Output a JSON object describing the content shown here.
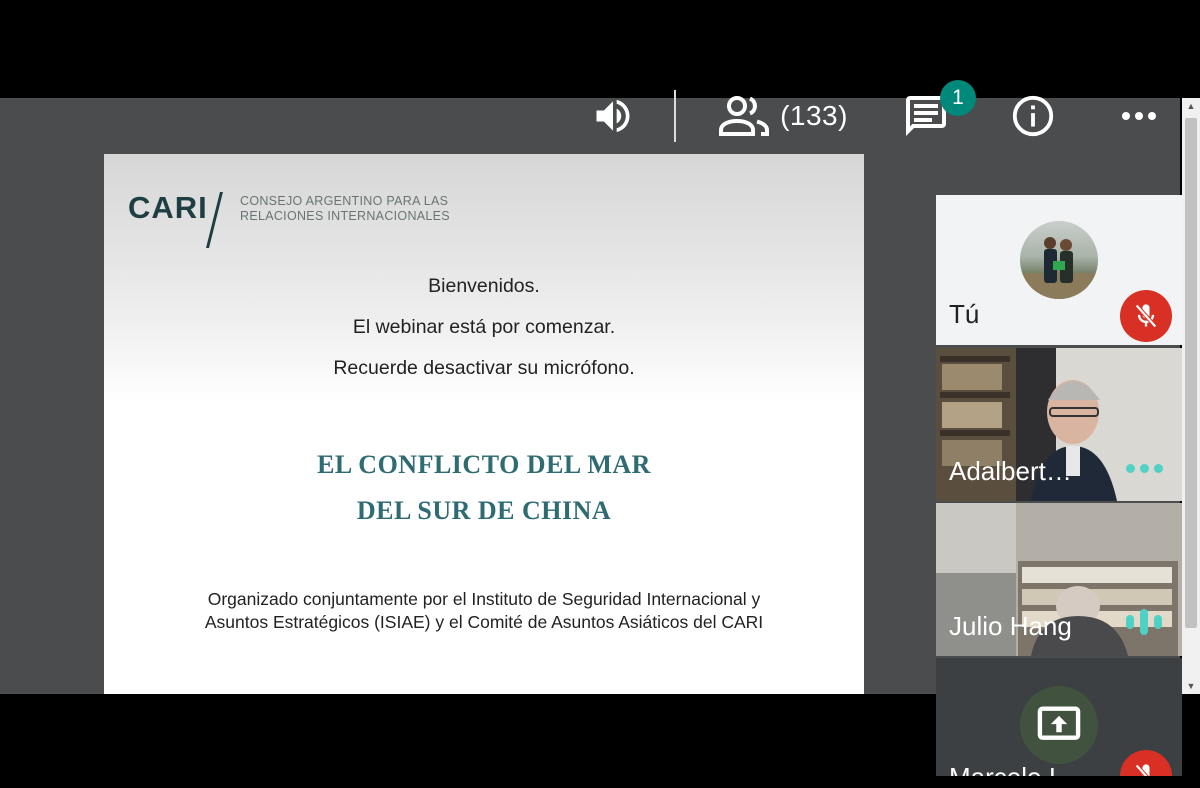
{
  "toolbar": {
    "volume_icon": "volume-up-icon",
    "people_icon": "people-icon",
    "people_count": "(133)",
    "chat_icon": "chat-icon",
    "chat_badge": "1",
    "info_icon": "info-icon",
    "more_icon": "more-horizontal-icon"
  },
  "slide": {
    "logo": "CARI",
    "logo_subtitle_line1": "CONSEJO ARGENTINO PARA LAS",
    "logo_subtitle_line2": "RELACIONES INTERNACIONALES",
    "welcome": [
      "Bienvenidos.",
      "El webinar está por comenzar.",
      "Recuerde desactivar su micrófono."
    ],
    "title": [
      "EL CONFLICTO DEL MAR",
      "DEL SUR DE CHINA"
    ],
    "organizer": [
      "Organizado conjuntamente por el Instituto de Seguridad Internacional y",
      "Asuntos Estratégicos (ISIAE) y el Comité de Asuntos Asiáticos del CARI"
    ]
  },
  "participants": [
    {
      "name": "Tú",
      "status": "mic-off"
    },
    {
      "name": "Adalbert…",
      "status": "more"
    },
    {
      "name": "Julio Hang",
      "status": "speaking"
    },
    {
      "name": "Marcelo I",
      "status": "presenting"
    }
  ],
  "colors": {
    "accent_teal": "#00897b",
    "mic_off_red": "#d93025",
    "title_teal": "#2e6b72"
  }
}
